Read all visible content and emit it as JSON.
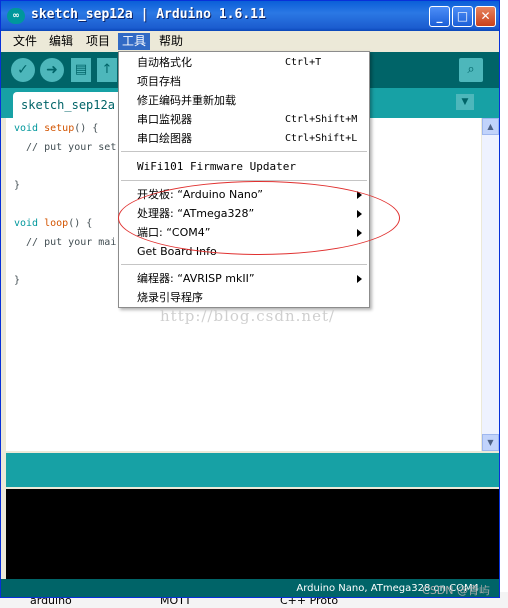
{
  "window": {
    "title": "sketch_sep12a | Arduino 1.6.11",
    "icon_text": "∞"
  },
  "menubar": {
    "items": [
      "文件",
      "编辑",
      "项目",
      "工具",
      "帮助"
    ],
    "active": "工具"
  },
  "tab": {
    "label": "sketch_sep12a"
  },
  "editor": {
    "lines": [
      {
        "kw": "void ",
        "fn": "setup",
        "rest": "() {"
      },
      {
        "text": "  // put your set"
      },
      {
        "text": ""
      },
      {
        "text": "}"
      },
      {
        "text": ""
      },
      {
        "kw": "void ",
        "fn": "loop",
        "rest": "() {"
      },
      {
        "text": "  // put your mai"
      },
      {
        "text": ""
      },
      {
        "text": "}"
      }
    ]
  },
  "tools_menu": {
    "auto_format": "自动格式化",
    "auto_format_sc": "Ctrl+T",
    "archive": "项目存档",
    "fix_encoding": "修正编码并重新加载",
    "serial_monitor": "串口监视器",
    "serial_monitor_sc": "Ctrl+Shift+M",
    "serial_plotter": "串口绘图器",
    "serial_plotter_sc": "Ctrl+Shift+L",
    "wifi_updater": "WiFi101 Firmware Updater",
    "board": "开发板: “Arduino Nano”",
    "processor": "处理器: “ATmega328”",
    "port": "端口: “COM4”",
    "board_info": "Get Board Info",
    "programmer": "编程器: “AVRISP mkII”",
    "burn_bootloader": "烧录引导程序"
  },
  "footer": {
    "status": "Arduino Nano, ATmega328 on COM4"
  },
  "watermark": {
    "url": "http://blog.csdn.net/",
    "csdn": "CSDN @青屿"
  },
  "background": {
    "item1": "arduino",
    "item2": "MOTT",
    "item3": "C++ Proto"
  },
  "colors": {
    "toolbar": "#006468",
    "tabbar": "#17a1a5",
    "menu_highlight": "#316ac5",
    "annotation": "#e0302f"
  }
}
